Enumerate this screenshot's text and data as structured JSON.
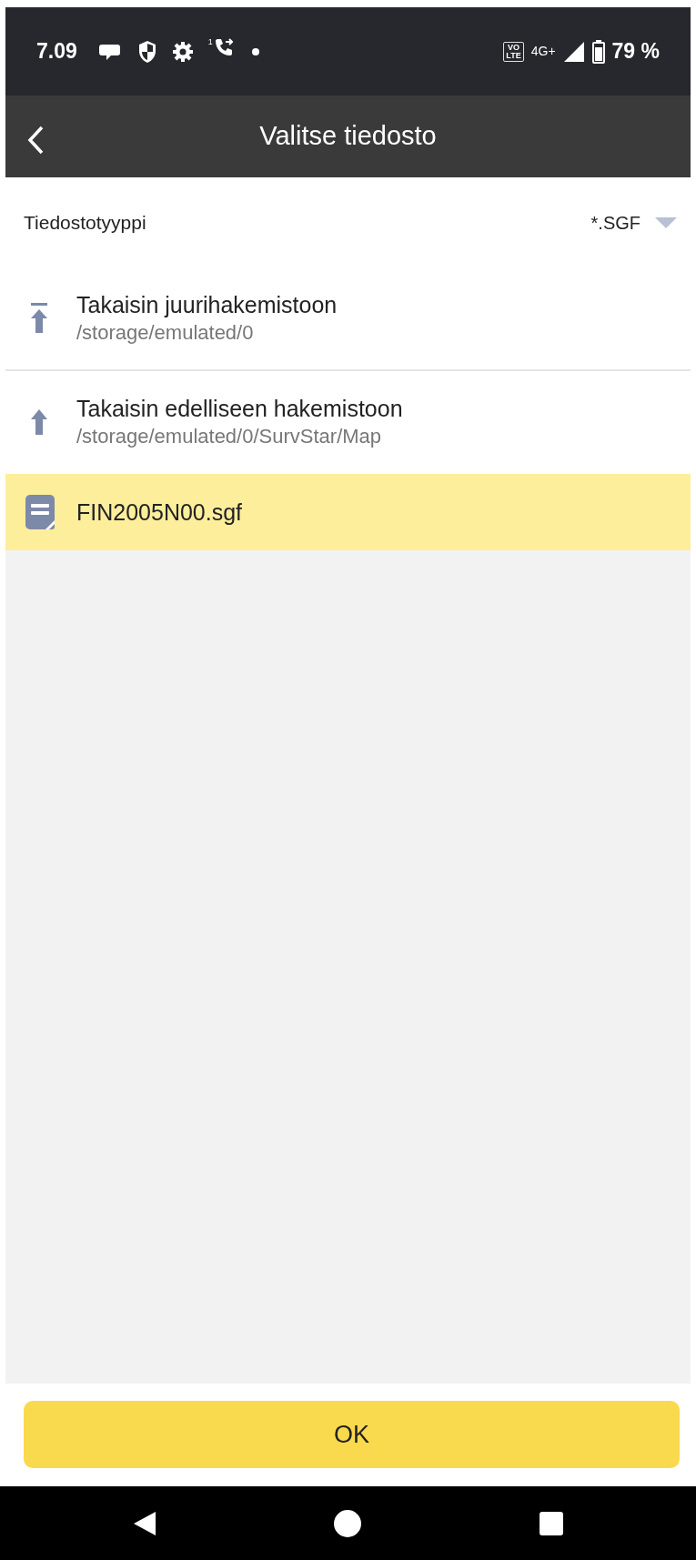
{
  "status_bar": {
    "time": "7.09",
    "sim_label": "1",
    "volte_top": "VO",
    "volte_bottom": "LTE",
    "network": "4G+",
    "battery": "79 %"
  },
  "header": {
    "title": "Valitse tiedosto"
  },
  "file_type": {
    "label": "Tiedostotyyppi",
    "value": "*.SGF"
  },
  "items": [
    {
      "kind": "root",
      "title": "Takaisin juurihakemistoon",
      "path": "/storage/emulated/0",
      "selected": false
    },
    {
      "kind": "parent",
      "title": "Takaisin edelliseen hakemistoon",
      "path": "/storage/emulated/0/SurvStar/Map",
      "selected": false
    },
    {
      "kind": "file",
      "title": "FIN2005N00.sgf",
      "selected": true
    }
  ],
  "ok_button": "OK"
}
